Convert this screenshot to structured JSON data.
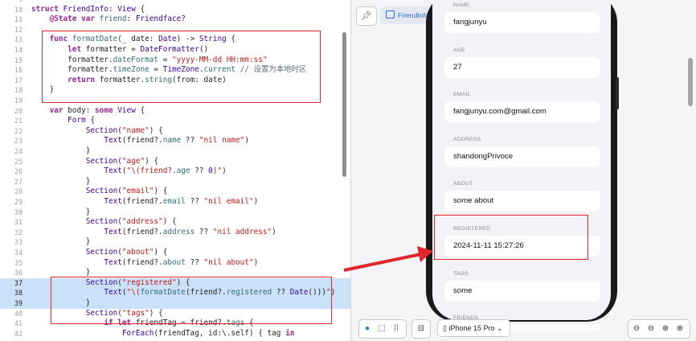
{
  "editor": {
    "lines": [
      {
        "n": "9",
        "segs": [
          {
            "t": ""
          }
        ]
      },
      {
        "n": "10",
        "segs": [
          {
            "c": "kw",
            "t": "struct "
          },
          {
            "c": "ty",
            "t": "FriendInfo"
          },
          {
            "t": ": "
          },
          {
            "c": "ty",
            "t": "View"
          },
          {
            "t": " {"
          }
        ]
      },
      {
        "n": "11",
        "segs": [
          {
            "t": "    "
          },
          {
            "c": "kw",
            "t": "@State var "
          },
          {
            "c": "pr",
            "t": "friend"
          },
          {
            "t": ": "
          },
          {
            "c": "ty",
            "t": "Friendface"
          },
          {
            "t": "?"
          }
        ]
      },
      {
        "n": "12",
        "segs": [
          {
            "t": ""
          }
        ]
      },
      {
        "n": "13",
        "segs": [
          {
            "t": "    "
          },
          {
            "c": "kw",
            "t": "func "
          },
          {
            "c": "fn",
            "t": "formatDate"
          },
          {
            "t": "(_ date: "
          },
          {
            "c": "ty",
            "t": "Date"
          },
          {
            "t": ") -> "
          },
          {
            "c": "ty",
            "t": "String"
          },
          {
            "t": " {"
          }
        ]
      },
      {
        "n": "14",
        "segs": [
          {
            "t": "        "
          },
          {
            "c": "kw",
            "t": "let "
          },
          {
            "t": "formatter = "
          },
          {
            "c": "ty",
            "t": "DateFormatter"
          },
          {
            "t": "()"
          }
        ]
      },
      {
        "n": "15",
        "segs": [
          {
            "t": "        formatter."
          },
          {
            "c": "pr",
            "t": "dateFormat"
          },
          {
            "t": " = "
          },
          {
            "c": "str",
            "t": "\"yyyy-MM-dd HH:mm:ss\""
          }
        ]
      },
      {
        "n": "16",
        "segs": [
          {
            "t": "        formatter."
          },
          {
            "c": "pr",
            "t": "timeZone"
          },
          {
            "t": " = "
          },
          {
            "c": "ty",
            "t": "TimeZone"
          },
          {
            "t": "."
          },
          {
            "c": "pr",
            "t": "current"
          },
          {
            "t": " "
          },
          {
            "c": "cm",
            "t": "// 设置为本地时区"
          }
        ]
      },
      {
        "n": "17",
        "segs": [
          {
            "t": "        "
          },
          {
            "c": "kw",
            "t": "return "
          },
          {
            "t": "formatter."
          },
          {
            "c": "fn",
            "t": "string"
          },
          {
            "t": "(from: date)"
          }
        ]
      },
      {
        "n": "18",
        "segs": [
          {
            "t": "    }"
          }
        ]
      },
      {
        "n": "19",
        "segs": [
          {
            "t": ""
          }
        ]
      },
      {
        "n": "20",
        "segs": [
          {
            "t": "    "
          },
          {
            "c": "kw",
            "t": "var "
          },
          {
            "t": "body: "
          },
          {
            "c": "kw",
            "t": "some "
          },
          {
            "c": "ty",
            "t": "View"
          },
          {
            "t": " {"
          }
        ]
      },
      {
        "n": "21",
        "segs": [
          {
            "t": "        "
          },
          {
            "c": "ty",
            "t": "Form"
          },
          {
            "t": " {"
          }
        ]
      },
      {
        "n": "22",
        "segs": [
          {
            "t": "            "
          },
          {
            "c": "ty",
            "t": "Section"
          },
          {
            "t": "("
          },
          {
            "c": "str",
            "t": "\"name\""
          },
          {
            "t": ") {"
          }
        ]
      },
      {
        "n": "23",
        "segs": [
          {
            "t": "                "
          },
          {
            "c": "ty",
            "t": "Text"
          },
          {
            "t": "(friend?."
          },
          {
            "c": "pr",
            "t": "name"
          },
          {
            "t": " ?? "
          },
          {
            "c": "str",
            "t": "\"nil name\""
          },
          {
            "t": ")"
          }
        ]
      },
      {
        "n": "24",
        "segs": [
          {
            "t": "            }"
          }
        ]
      },
      {
        "n": "25",
        "segs": [
          {
            "t": "            "
          },
          {
            "c": "ty",
            "t": "Section"
          },
          {
            "t": "("
          },
          {
            "c": "str",
            "t": "\"age\""
          },
          {
            "t": ") {"
          }
        ]
      },
      {
        "n": "26",
        "segs": [
          {
            "t": "                "
          },
          {
            "c": "ty",
            "t": "Text"
          },
          {
            "t": "("
          },
          {
            "c": "str",
            "t": "\"\\(friend?."
          },
          {
            "c": "pr",
            "t": "age"
          },
          {
            "t": " ?? "
          },
          {
            "c": "num",
            "t": "0"
          },
          {
            "c": "str",
            "t": ")\""
          },
          {
            "t": ")"
          }
        ]
      },
      {
        "n": "27",
        "segs": [
          {
            "t": "            }"
          }
        ]
      },
      {
        "n": "28",
        "segs": [
          {
            "t": "            "
          },
          {
            "c": "ty",
            "t": "Section"
          },
          {
            "t": "("
          },
          {
            "c": "str",
            "t": "\"email\""
          },
          {
            "t": ") {"
          }
        ]
      },
      {
        "n": "29",
        "segs": [
          {
            "t": "                "
          },
          {
            "c": "ty",
            "t": "Text"
          },
          {
            "t": "(friend?."
          },
          {
            "c": "pr",
            "t": "email"
          },
          {
            "t": " ?? "
          },
          {
            "c": "str",
            "t": "\"nil email\""
          },
          {
            "t": ")"
          }
        ]
      },
      {
        "n": "30",
        "segs": [
          {
            "t": "            }"
          }
        ]
      },
      {
        "n": "31",
        "segs": [
          {
            "t": "            "
          },
          {
            "c": "ty",
            "t": "Section"
          },
          {
            "t": "("
          },
          {
            "c": "str",
            "t": "\"address\""
          },
          {
            "t": ") {"
          }
        ]
      },
      {
        "n": "32",
        "segs": [
          {
            "t": "                "
          },
          {
            "c": "ty",
            "t": "Text"
          },
          {
            "t": "(friend?."
          },
          {
            "c": "pr",
            "t": "address"
          },
          {
            "t": " ?? "
          },
          {
            "c": "str",
            "t": "\"nil address\""
          },
          {
            "t": ")"
          }
        ]
      },
      {
        "n": "33",
        "segs": [
          {
            "t": "            }"
          }
        ]
      },
      {
        "n": "34",
        "segs": [
          {
            "t": "            "
          },
          {
            "c": "ty",
            "t": "Section"
          },
          {
            "t": "("
          },
          {
            "c": "str",
            "t": "\"about\""
          },
          {
            "t": ") {"
          }
        ]
      },
      {
        "n": "35",
        "segs": [
          {
            "t": "                "
          },
          {
            "c": "ty",
            "t": "Text"
          },
          {
            "t": "(friend?."
          },
          {
            "c": "pr",
            "t": "about"
          },
          {
            "t": " ?? "
          },
          {
            "c": "str",
            "t": "\"nil about\""
          },
          {
            "t": ")"
          }
        ]
      },
      {
        "n": "36",
        "segs": [
          {
            "t": "            }"
          }
        ]
      },
      {
        "n": "37",
        "segs": [
          {
            "t": "            "
          },
          {
            "c": "ty",
            "t": "Section"
          },
          {
            "t": "("
          },
          {
            "c": "str",
            "t": "\"registered\""
          },
          {
            "t": ") {"
          }
        ]
      },
      {
        "n": "38",
        "segs": [
          {
            "t": "                "
          },
          {
            "c": "ty",
            "t": "Text"
          },
          {
            "t": "("
          },
          {
            "c": "str",
            "t": "\"\\("
          },
          {
            "c": "fn",
            "t": "formatDate"
          },
          {
            "t": "(friend?."
          },
          {
            "c": "pr",
            "t": "registered"
          },
          {
            "t": " ?? "
          },
          {
            "c": "ty",
            "t": "Date"
          },
          {
            "t": "()))"
          },
          {
            "c": "str",
            "t": "\""
          },
          {
            "t": ")"
          }
        ]
      },
      {
        "n": "39",
        "segs": [
          {
            "t": "            }"
          }
        ]
      },
      {
        "n": "40",
        "segs": [
          {
            "t": "            "
          },
          {
            "c": "ty",
            "t": "Section"
          },
          {
            "t": "("
          },
          {
            "c": "str",
            "t": "\"tags\""
          },
          {
            "t": ") {"
          }
        ]
      },
      {
        "n": "41",
        "segs": [
          {
            "t": "                "
          },
          {
            "c": "kw",
            "t": "if let "
          },
          {
            "t": "friendTag = friend?."
          },
          {
            "c": "pr",
            "t": "tags"
          },
          {
            "t": " {"
          }
        ]
      },
      {
        "n": "42",
        "segs": [
          {
            "t": "                    "
          },
          {
            "c": "ty",
            "t": "ForEach"
          },
          {
            "t": "(friendTag, id:\\.self) { tag "
          },
          {
            "c": "kw",
            "t": "in"
          }
        ]
      }
    ],
    "highlighted_lines": [
      "37",
      "38",
      "39"
    ]
  },
  "canvas": {
    "tab_label": "FriendInfo",
    "device_label": "iPhone 15 Pro",
    "sections": [
      {
        "header": "NAME",
        "value": "fangjunyu"
      },
      {
        "header": "AGE",
        "value": "27"
      },
      {
        "header": "EMAIL",
        "value": "fangjunyu.com@gmail.com"
      },
      {
        "header": "ADDRESS",
        "value": "shandongPrivoce"
      },
      {
        "header": "ABOUT",
        "value": "some about"
      },
      {
        "header": "REGISTERED",
        "value": "2024-11-11 15:27:26"
      },
      {
        "header": "TAGS",
        "value": "some"
      },
      {
        "header": "FRIENDS",
        "value": ""
      }
    ]
  },
  "colors": {
    "annotation_red": "#e0262a",
    "highlight": "#cbe1f7",
    "accent": "#2f6fd6"
  },
  "icons": [
    "pin-icon",
    "friendinfo-preview-icon",
    "play-icon",
    "select-icon",
    "grid-icon",
    "device-settings-icon",
    "device-icon",
    "chevron-down-icon",
    "zoom-out-icon",
    "zoom-fit-icon",
    "zoom-actual-icon",
    "zoom-in-icon"
  ]
}
